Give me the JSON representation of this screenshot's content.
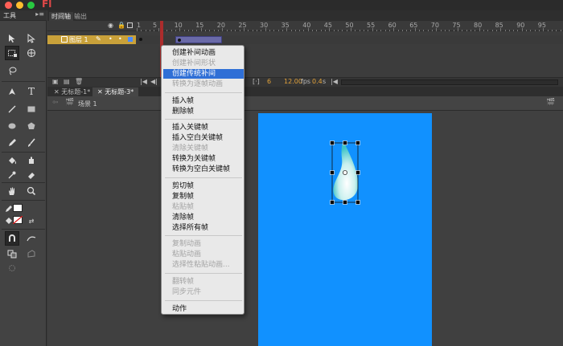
{
  "titlebar": {
    "app_glyph": "Fl",
    "colors": {
      "close": "#ff5f57",
      "min": "#febc2e",
      "max": "#28c840"
    }
  },
  "tools": {
    "header_label": "工具",
    "menu_button": "▸≡",
    "icons": [
      "selection-tool",
      "subselection-tool",
      "free-transform-tool",
      "3d-rotation-tool",
      "lasso-tool",
      "pen-tool",
      "text-tool",
      "line-tool",
      "rectangle-tool",
      "oval-tool",
      "polystar-tool",
      "pencil-tool",
      "brush-tool",
      "paint-bucket-tool",
      "ink-bottle-tool",
      "eyedropper-tool",
      "eraser-tool",
      "hand-tool",
      "zoom-tool",
      "stroke-color",
      "fill-color",
      "swap-colors",
      "snap-magnet",
      "smooth",
      "straighten"
    ]
  },
  "timeline": {
    "tabs": [
      "时间轴",
      "输出"
    ],
    "active_tab": "时间轴",
    "header_icons": [
      "eye-icon",
      "lock-icon",
      "outline-icon"
    ],
    "ruler_numbers": [
      "1",
      "5",
      "10",
      "15",
      "20",
      "25",
      "30",
      "35",
      "40",
      "45",
      "50",
      "55",
      "60",
      "65",
      "70",
      "75",
      "80",
      "85",
      "90",
      "95"
    ],
    "layer": {
      "name": "图层 1"
    },
    "footer": {
      "frame": "6",
      "fps": "12.00",
      "fps_unit": "fps",
      "time": "0.4",
      "time_unit": "s"
    },
    "colors": {
      "layer_highlight": "#c9a13a",
      "selection": "#6a6aa8",
      "playhead": "#b22b2b"
    }
  },
  "documents": {
    "tabs": [
      "无标题-1*",
      "无标题-3*"
    ],
    "active_tab": "无标题-3*",
    "scene_label": "场景 1"
  },
  "stage": {
    "color": "#1191ff"
  },
  "context_menu": {
    "groups": [
      [
        {
          "label": "创建补间动画",
          "enabled": true
        },
        {
          "label": "创建补间形状",
          "enabled": false
        },
        {
          "label": "创建传统补间",
          "enabled": true,
          "highlighted": true
        },
        {
          "label": "转换为逐帧动画",
          "enabled": false
        }
      ],
      [
        {
          "label": "插入帧",
          "enabled": true
        },
        {
          "label": "删除帧",
          "enabled": true
        }
      ],
      [
        {
          "label": "插入关键帧",
          "enabled": true
        },
        {
          "label": "插入空白关键帧",
          "enabled": true
        },
        {
          "label": "清除关键帧",
          "enabled": false
        },
        {
          "label": "转换为关键帧",
          "enabled": true
        },
        {
          "label": "转换为空白关键帧",
          "enabled": true
        }
      ],
      [
        {
          "label": "剪切帧",
          "enabled": true
        },
        {
          "label": "复制帧",
          "enabled": true
        },
        {
          "label": "粘贴帧",
          "enabled": false
        },
        {
          "label": "清除帧",
          "enabled": true
        },
        {
          "label": "选择所有帧",
          "enabled": true
        }
      ],
      [
        {
          "label": "复制动画",
          "enabled": false
        },
        {
          "label": "粘贴动画",
          "enabled": false
        },
        {
          "label": "选择性粘贴动画...",
          "enabled": false
        }
      ],
      [
        {
          "label": "翻转帧",
          "enabled": false
        },
        {
          "label": "同步元件",
          "enabled": false
        }
      ],
      [
        {
          "label": "动作",
          "enabled": true
        }
      ]
    ]
  }
}
